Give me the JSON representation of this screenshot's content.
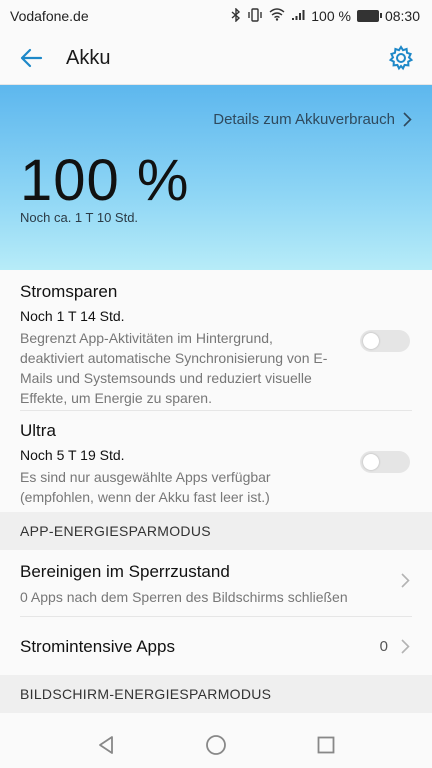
{
  "status_bar": {
    "carrier": "Vodafone.de",
    "battery_percent": "100 %",
    "time": "08:30",
    "icons": [
      "bluetooth-icon",
      "vibrate-icon",
      "wifi-icon",
      "signal-icon",
      "battery-icon"
    ]
  },
  "app_bar": {
    "title": "Akku",
    "back_icon": "back-arrow-icon",
    "settings_icon": "gear-icon"
  },
  "hero": {
    "details_link": "Details zum Akkuverbrauch",
    "percent": "100 %",
    "remaining": "Noch ca. 1 T 10 Std."
  },
  "power_modes": [
    {
      "title": "Stromsparen",
      "duration": "Noch 1 T 14 Std.",
      "description": "Begrenzt App-Aktivitäten im Hintergrund, deaktiviert automatische Synchronisierung von E-Mails und Systemsounds und reduziert visuelle Effekte, um Energie zu sparen.",
      "enabled": false
    },
    {
      "title": "Ultra",
      "duration": "Noch 5 T 19 Std.",
      "description": "Es sind nur ausgewählte Apps verfügbar (empfohlen, wenn der Akku fast leer ist.)",
      "enabled": false
    }
  ],
  "app_section": {
    "header": "APP-ENERGIESPARMODUS",
    "cleanup_title": "Bereinigen im Sperrzustand",
    "cleanup_subtitle": "0 Apps nach dem Sperren des Bildschirms schließen",
    "intensive_title": "Stromintensive Apps",
    "intensive_count": "0"
  },
  "screen_section": {
    "header": "BILDSCHIRM-ENERGIESPARMODUS"
  },
  "colors": {
    "accent": "#1e88c8",
    "hero_top": "#5db7ee",
    "hero_bottom": "#b7ecf8"
  }
}
